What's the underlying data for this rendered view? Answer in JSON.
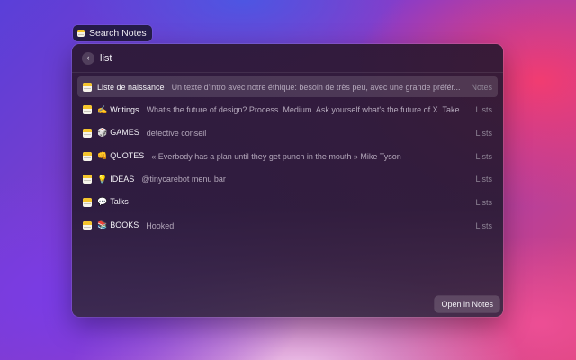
{
  "pill": {
    "icon": "notes-app-icon",
    "label": "Search Notes"
  },
  "search": {
    "query": "list",
    "back_icon": "chevron-left-icon"
  },
  "items": [
    {
      "emoji": "",
      "title": "Liste de naissance",
      "subtitle": "Un texte d'intro avec notre éthique: besoin de très peu, avec une grande préfér...",
      "accessory": "Notes",
      "selected": true
    },
    {
      "emoji": "✍️",
      "title": "Writings",
      "subtitle": "What's the future of design? Process. Medium. Ask yourself what's the future of X. Take...",
      "accessory": "Lists"
    },
    {
      "emoji": "🎲",
      "title": "GAMES",
      "subtitle": "detective conseil",
      "accessory": "Lists"
    },
    {
      "emoji": "👊",
      "title": "QUOTES",
      "subtitle": "« Everbody has a plan until they get punch in the mouth » Mike Tyson",
      "accessory": "Lists"
    },
    {
      "emoji": "💡",
      "title": "IDEAS",
      "subtitle": "@tinycarebot menu bar",
      "accessory": "Lists"
    },
    {
      "emoji": "💬",
      "title": "Talks",
      "subtitle": "",
      "accessory": "Lists"
    },
    {
      "emoji": "📚",
      "title": "BOOKS",
      "subtitle": "Hooked",
      "accessory": "Lists"
    }
  ],
  "actions": {
    "primary_label": "Open in Notes"
  }
}
